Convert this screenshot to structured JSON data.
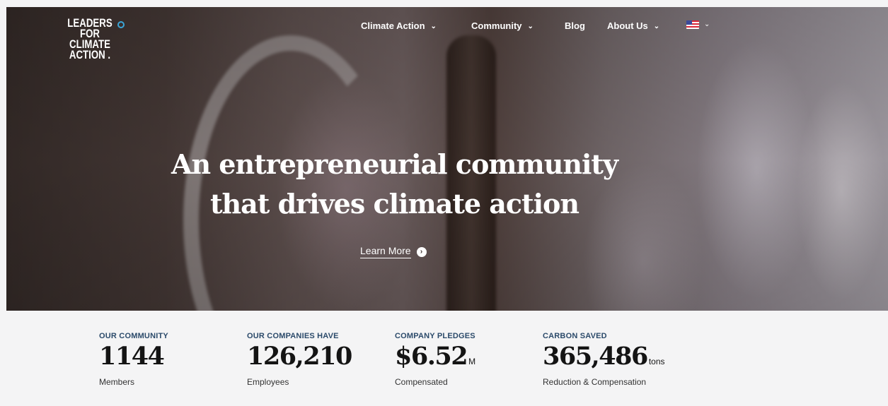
{
  "logo": {
    "lines": [
      "LEADERS",
      "FOR",
      "CLIMATE",
      "ACTION ."
    ],
    "accent_color": "#3aa6d8"
  },
  "nav": {
    "items": [
      {
        "label": "Climate Action",
        "has_dropdown": true
      },
      {
        "label": "Community",
        "has_dropdown": true
      },
      {
        "label": "Blog",
        "has_dropdown": false
      },
      {
        "label": "About Us",
        "has_dropdown": true
      }
    ],
    "language_icon": "us-flag-icon",
    "dropdown_glyph": "⌄"
  },
  "hero": {
    "headline_line1": "An entrepreneurial community",
    "headline_line2": "that drives climate action",
    "cta_label": "Learn More",
    "cta_icon": "arrow-circle-icon",
    "cta_glyph": "›"
  },
  "stats": [
    {
      "label": "OUR COMMUNITY",
      "value": "1144",
      "unit": "",
      "sub": "Members"
    },
    {
      "label": "OUR COMPANIES HAVE",
      "value": "126,210",
      "unit": "",
      "sub": "Employees"
    },
    {
      "label": "COMPANY PLEDGES",
      "value": "$6.52",
      "unit": "M",
      "sub": "Compensated"
    },
    {
      "label": "CARBON SAVED",
      "value": "365,486",
      "unit": "tons",
      "sub": "Reduction & Compensation"
    }
  ]
}
